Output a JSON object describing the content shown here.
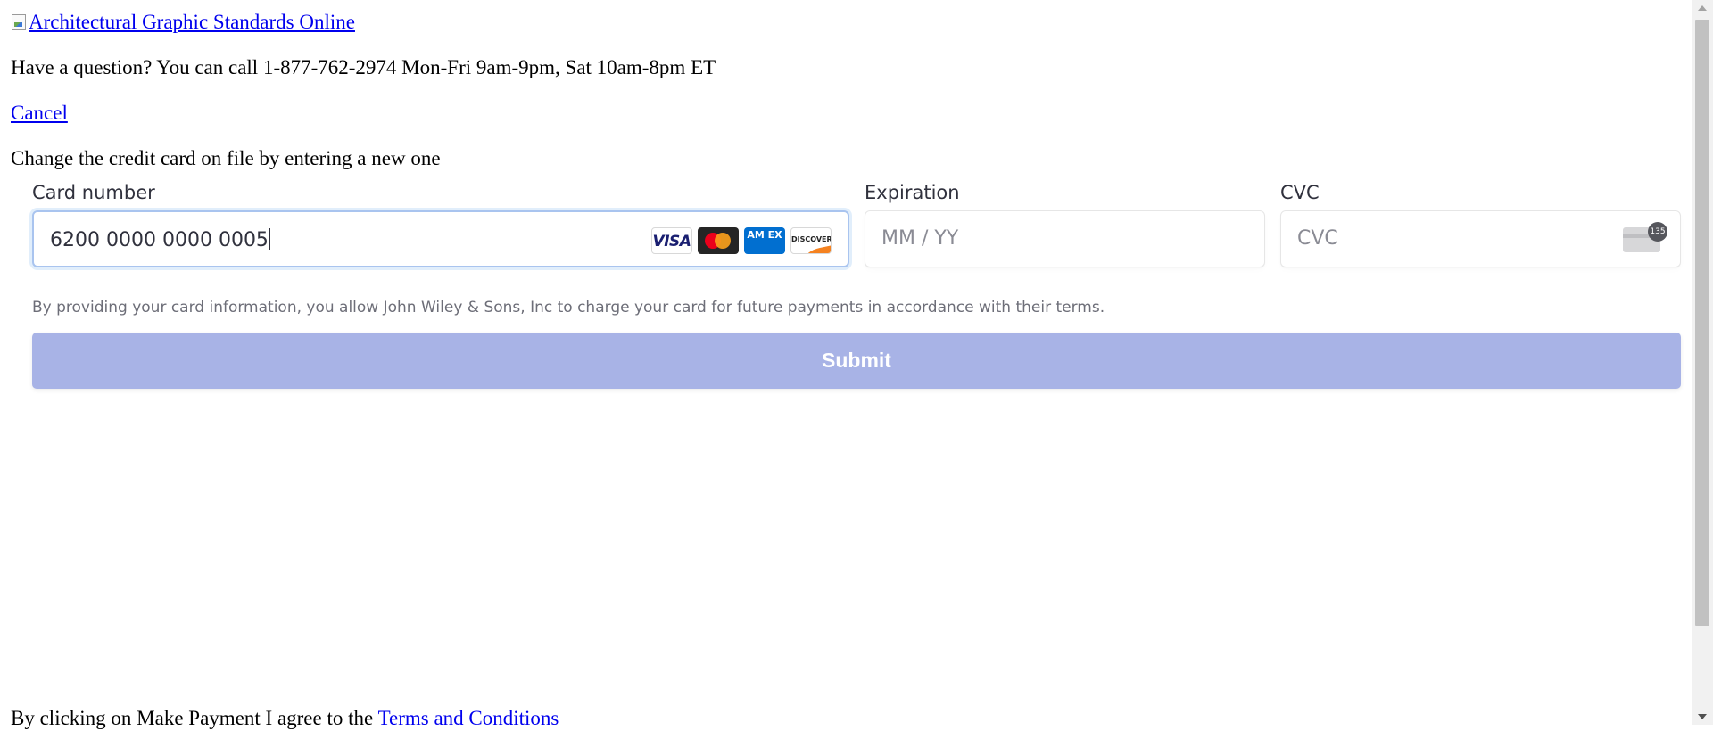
{
  "header": {
    "logo_alt": "Architectural Graphic Standards Online",
    "question_text": "Have a question? You can call 1-877-762-2974 Mon-Fri 9am-9pm, Sat 10am-8pm ET",
    "cancel_label": "Cancel",
    "instruction": "Change the credit card on file by entering a new one"
  },
  "payment_form": {
    "card_number": {
      "label": "Card number",
      "value": "6200 0000 0000 0005",
      "brands": [
        {
          "name": "visa-icon",
          "text": "VISA"
        },
        {
          "name": "mastercard-icon",
          "text": ""
        },
        {
          "name": "amex-icon",
          "text": "AM EX"
        },
        {
          "name": "discover-icon",
          "text": "DISCOVER"
        }
      ]
    },
    "expiration": {
      "label": "Expiration",
      "placeholder": "MM / YY"
    },
    "cvc": {
      "label": "CVC",
      "placeholder": "CVC",
      "icon_badge": "135"
    },
    "terms_text": "By providing your card information, you allow John Wiley & Sons, Inc to charge your card for future payments in accordance with their terms.",
    "submit_label": "Submit",
    "colors": {
      "submit_bg": "#a8b3e6",
      "focus_border": "#a9c4ef"
    }
  },
  "footer": {
    "agreement_prefix": "By clicking on Make Payment I agree to the ",
    "terms_link": "Terms and Conditions"
  }
}
